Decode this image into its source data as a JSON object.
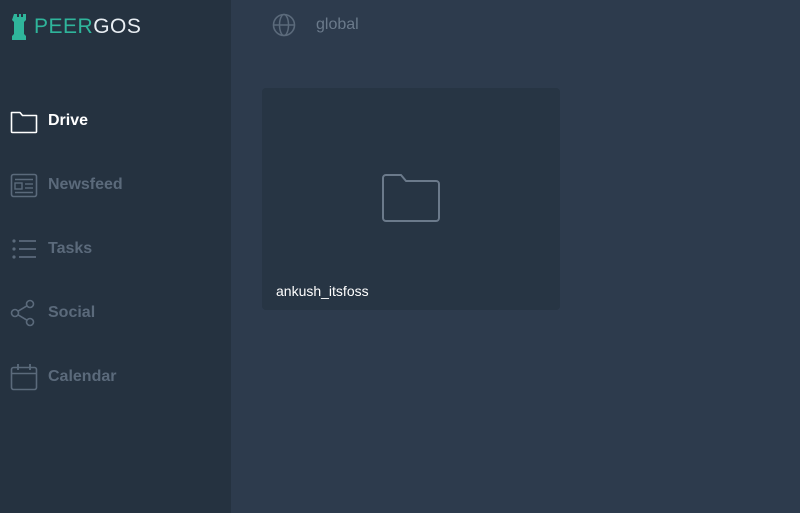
{
  "app": {
    "logo_part1": "PEER",
    "logo_part2": "GOS"
  },
  "sidebar": {
    "items": [
      {
        "label": "Drive",
        "icon": "folder-icon",
        "active": true
      },
      {
        "label": "Newsfeed",
        "icon": "newspaper-icon",
        "active": false
      },
      {
        "label": "Tasks",
        "icon": "list-icon",
        "active": false
      },
      {
        "label": "Social",
        "icon": "share-icon",
        "active": false
      },
      {
        "label": "Calendar",
        "icon": "calendar-icon",
        "active": false
      }
    ]
  },
  "topbar": {
    "icon": "globe-icon",
    "path": "global"
  },
  "main": {
    "items": [
      {
        "name": "ankush_itsfoss",
        "type": "folder",
        "icon": "folder-icon"
      }
    ]
  },
  "colors": {
    "accent": "#2fb59b",
    "sidebar_bg": "#253240",
    "main_bg": "#2d3b4d",
    "card_bg": "#273544",
    "inactive_text": "#5b6a7b",
    "active_text": "#ffffff"
  }
}
